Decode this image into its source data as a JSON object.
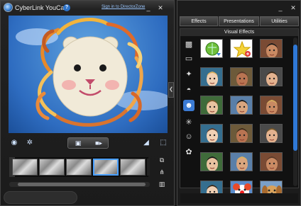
{
  "app": {
    "title": "CyberLink YouCam",
    "sign_in_text": "Sign in to DirectorZone",
    "help_icon": "?"
  },
  "window_controls": {
    "minimize": "_",
    "close": "✕"
  },
  "tabs": [
    "Effects",
    "Presentations",
    "Utilities"
  ],
  "panel": {
    "section_title": "Visual Effects"
  },
  "categories": [
    {
      "icon": "frame-icon"
    },
    {
      "icon": "screen-icon"
    },
    {
      "icon": "sparkle-icon"
    },
    {
      "icon": "mask-icon"
    },
    {
      "icon": "avatar-icon",
      "active": true
    },
    {
      "icon": "distortion-icon"
    },
    {
      "icon": "emoticon-icon"
    },
    {
      "icon": "gadget-icon"
    }
  ],
  "effects": [
    "globe-download",
    "star-plus",
    "face-1",
    "face-2",
    "face-3",
    "face-4",
    "face-5",
    "face-6",
    "face-7",
    "face-8",
    "face-9",
    "face-10",
    "face-11",
    "face-12",
    "face-13",
    "face-14",
    "clown-face",
    "dog-face"
  ],
  "colors": {
    "accent": "#3b7bd4",
    "sky": "#2e6cc0",
    "yarn_orange": "#e07a2a",
    "face": "#f1ead8"
  }
}
